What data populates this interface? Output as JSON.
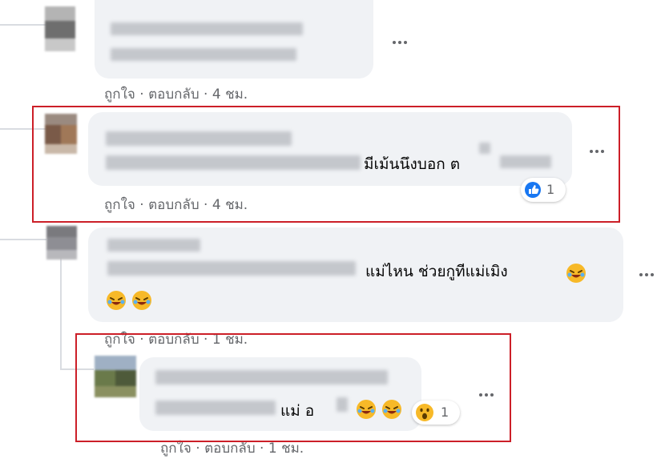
{
  "actions": {
    "like": "ถูกใจ",
    "sep": "·",
    "reply": "ตอบกลับ",
    "time_4h": "4 ชม.",
    "time_1h": "1 ชม."
  },
  "comments": [
    {
      "text": ""
    },
    {
      "text": "มีเม้นนึงบอก ต",
      "reaction_count": "1",
      "reaction_icon": "like-icon",
      "reaction_color": "#1877f2"
    },
    {
      "text": "แม่ไหน ช่วยกูทีแม่เมิง",
      "emoji": "laughing-emoji"
    },
    {
      "text": "แม่ อ",
      "reaction_count": "1",
      "reaction_icon": "wow-emoji"
    }
  ],
  "colors": {
    "highlight": "#cc1f28",
    "bubble": "#f0f2f5",
    "meta": "#65676b"
  }
}
